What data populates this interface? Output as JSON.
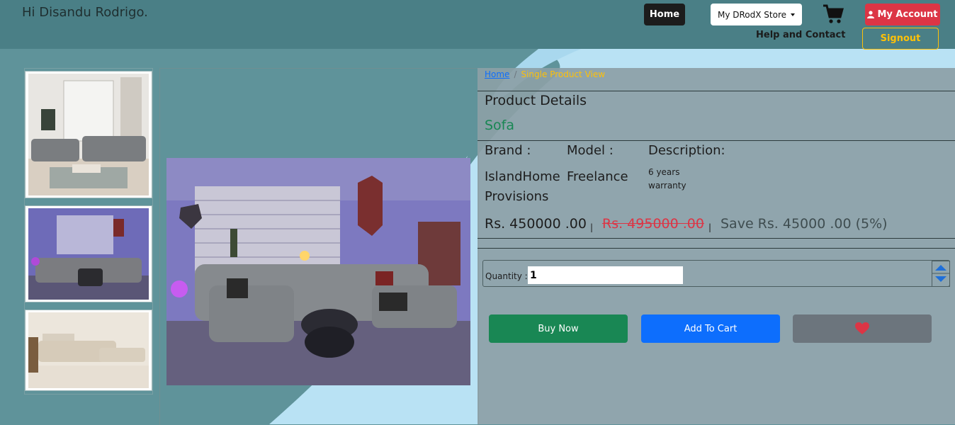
{
  "header": {
    "greeting": "Hi Disandu Rodrigo.",
    "home_label": "Home",
    "store_label": "My DRodX Store",
    "account_label": "My Account",
    "help_label": "Help and Contact",
    "signout_label": "Signout"
  },
  "breadcrumb": {
    "home": "Home",
    "current": "Single Product View"
  },
  "product": {
    "section_title": "Product Details",
    "name": "Sofa",
    "brand_label": "Brand :",
    "model_label": "Model :",
    "description_label": "Description:",
    "brand_line1": "IslandHome",
    "brand_line2": "Provisions",
    "model": "Freelance",
    "description_line1": "6 years",
    "description_line2": "warranty",
    "price": "Rs. 450000 .00",
    "old_price": "Rs. 495000 .00",
    "savings": "Save Rs. 45000 .00 (5%)",
    "separator": "|"
  },
  "quantity": {
    "label": "Quantity :",
    "value": "1"
  },
  "actions": {
    "buy_label": "Buy Now",
    "cart_label": "Add To Cart"
  },
  "colors": {
    "accent_success": "#198754",
    "accent_primary": "#0d6efd",
    "accent_danger": "#dc3545",
    "accent_warning": "#ffc107"
  }
}
